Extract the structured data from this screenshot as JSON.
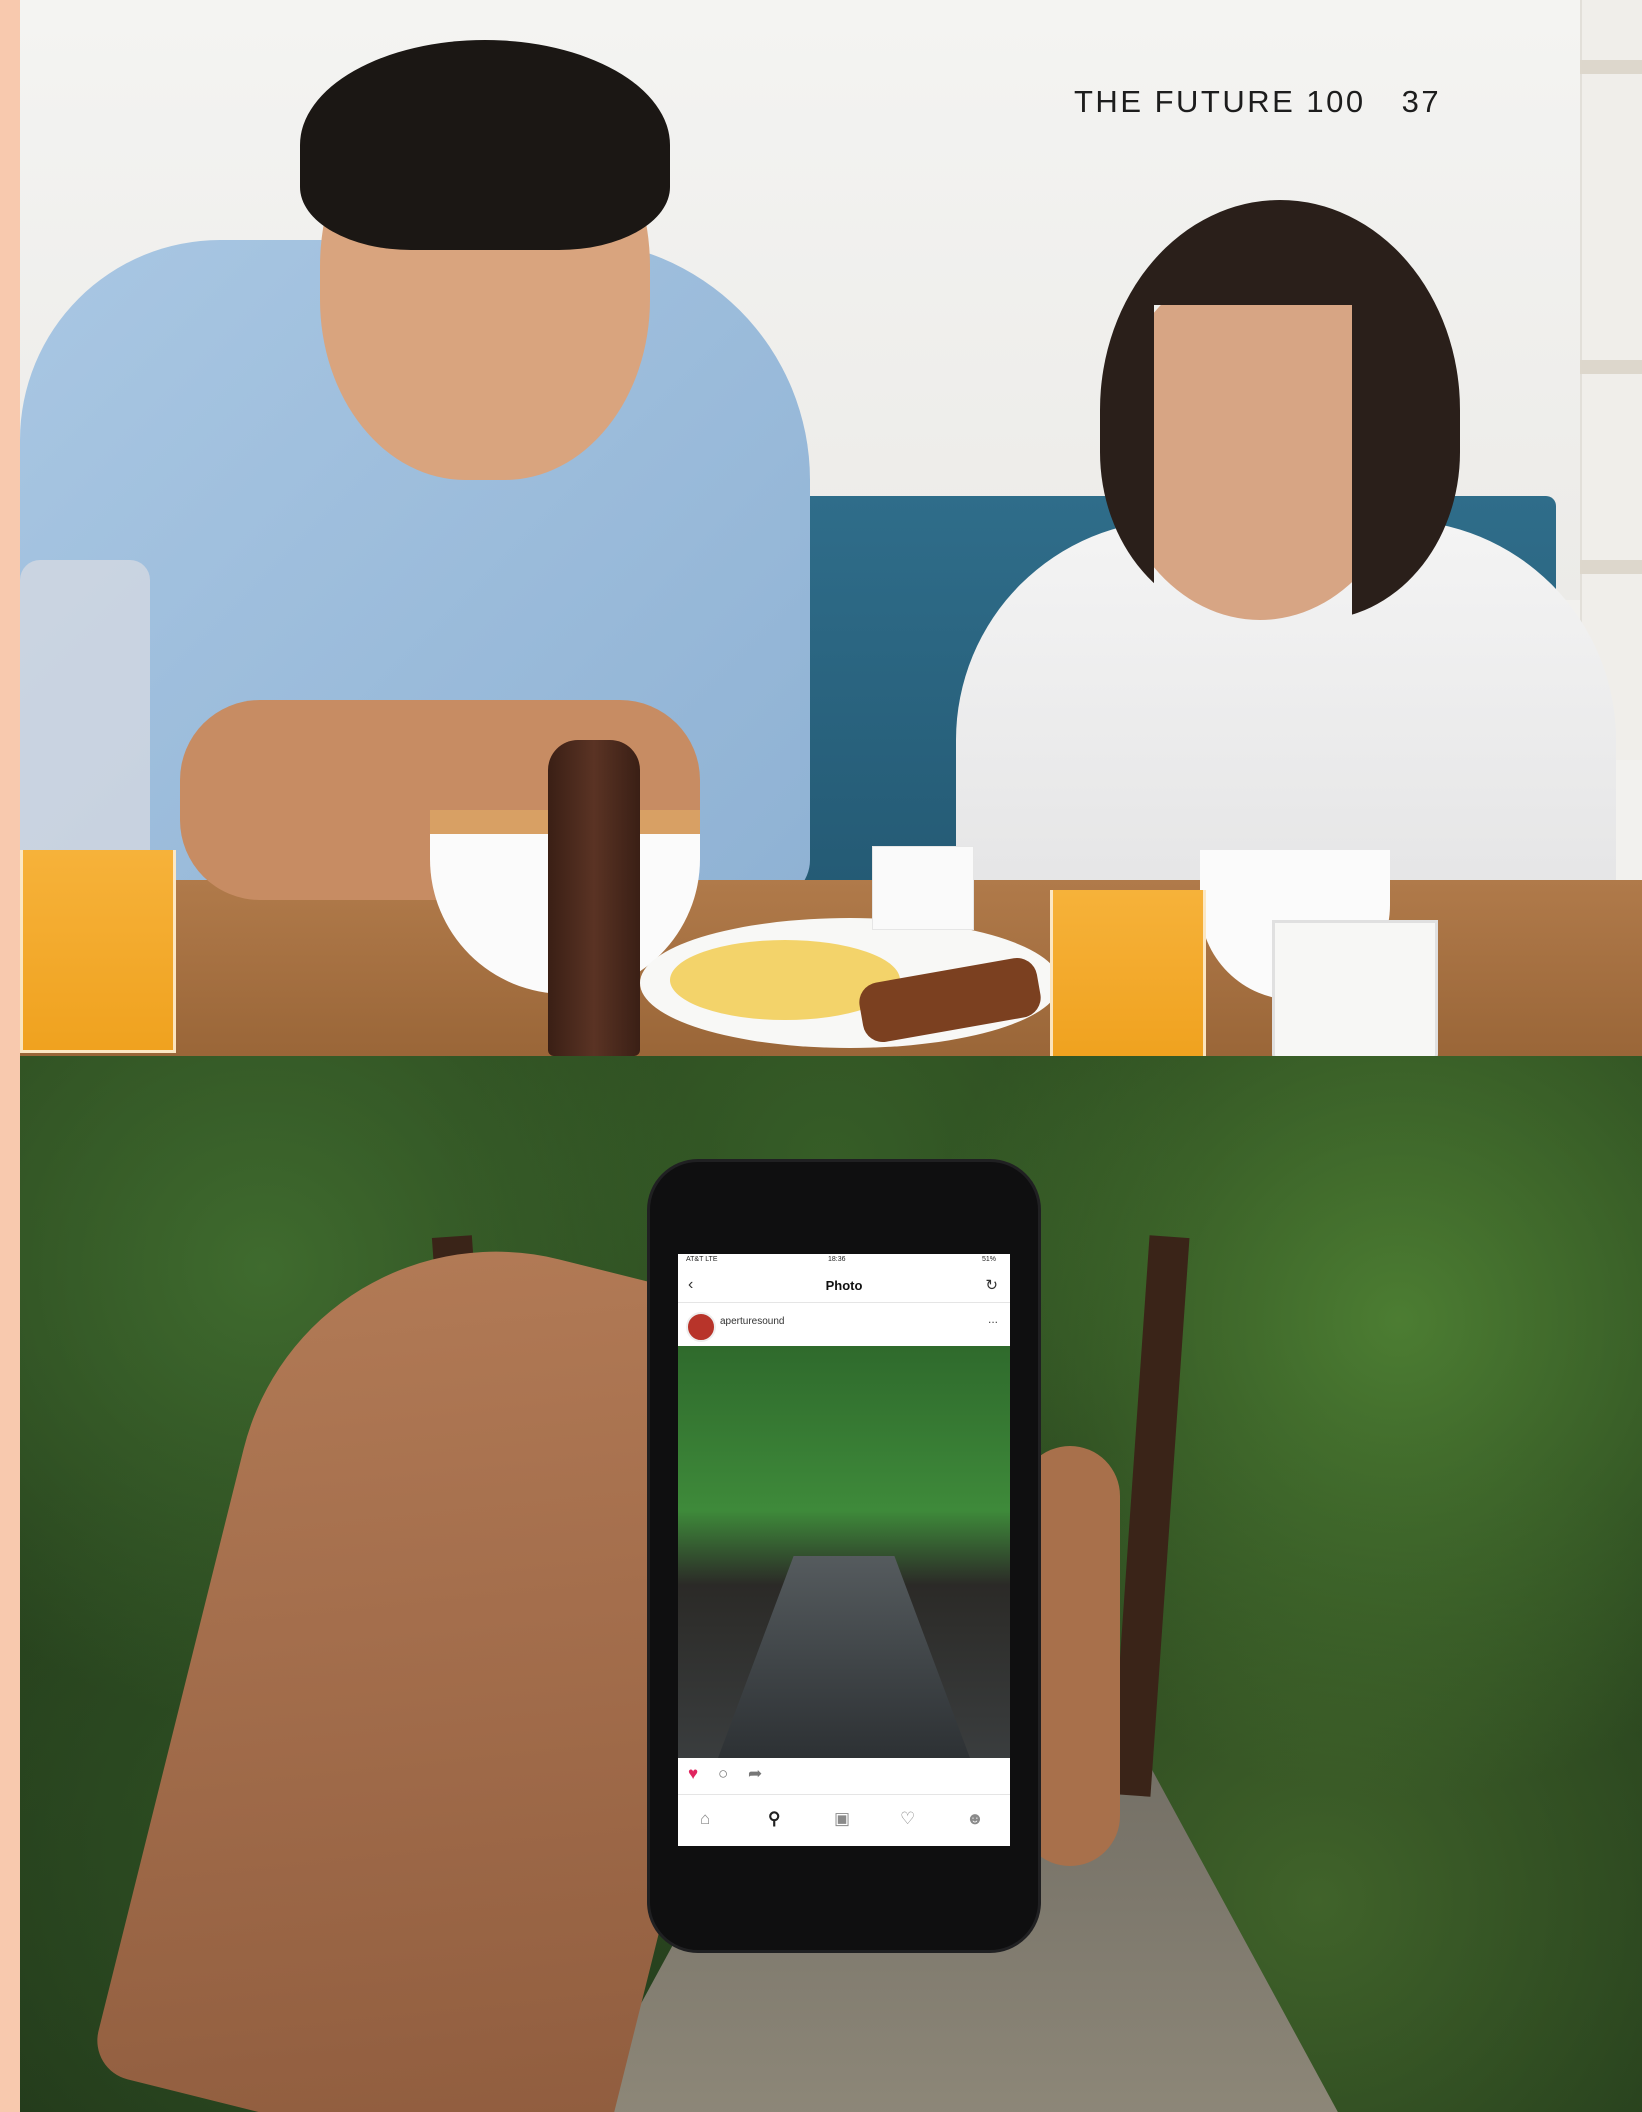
{
  "header": {
    "publication": "THE FUTURE 100",
    "page_number": "37"
  },
  "phone_screen": {
    "status": {
      "carrier": "AT&T LTE",
      "time": "18:36",
      "battery": "51%"
    },
    "nav": {
      "back_icon": "chevron-left-icon",
      "title": "Photo",
      "refresh_icon": "refresh-icon"
    },
    "post": {
      "username": "aperturesound",
      "more_label": "..."
    },
    "actions": {
      "like_icon": "heart-icon",
      "comment_icon": "comment-icon",
      "share_icon": "share-icon",
      "like_color": "#e0245e"
    },
    "tabs": [
      "home-icon",
      "search-icon",
      "camera-icon",
      "heart-icon",
      "profile-icon"
    ]
  }
}
